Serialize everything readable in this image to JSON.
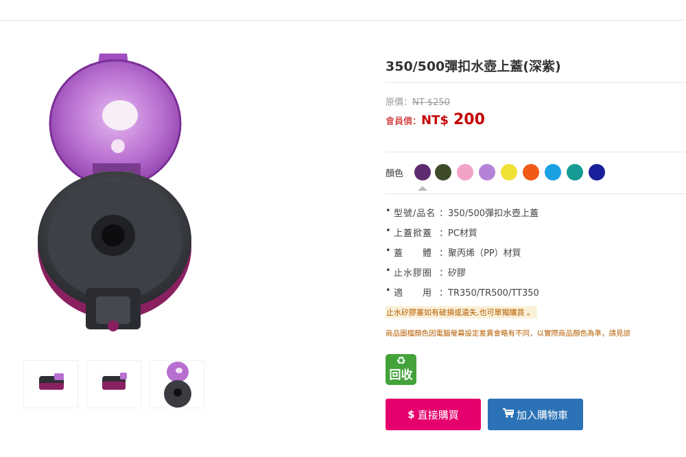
{
  "product": {
    "title": "350/500彈扣水壺上蓋(深紫)"
  },
  "pricing": {
    "original_label": "原價：",
    "original_price": "NT $250",
    "member_label": "會員價：",
    "member_currency": "NT$",
    "member_price": "200",
    "member_color": "#c40000"
  },
  "colors": {
    "label": "顏色",
    "options": [
      {
        "color": "#5e2b6e",
        "selected": true
      },
      {
        "color": "#3f4a2a",
        "selected": false
      },
      {
        "color": "#f4a3c8",
        "selected": false
      },
      {
        "color": "#b583d6",
        "selected": false
      },
      {
        "color": "#f2e135",
        "selected": false
      },
      {
        "color": "#f05a16",
        "selected": false
      },
      {
        "color": "#1ba0e2",
        "selected": false
      },
      {
        "color": "#159b94",
        "selected": false
      },
      {
        "color": "#1a1f9c",
        "selected": false
      }
    ]
  },
  "specs": [
    {
      "key": "型號/品名",
      "value": "：350/500彈扣水壺上蓋"
    },
    {
      "key": "上蓋掀蓋",
      "value": "：PC材質"
    },
    {
      "key": "蓋　　體",
      "value": "：聚丙烯（PP）材質"
    },
    {
      "key": "止水膠圈",
      "value": "：矽膠"
    },
    {
      "key": "適　　用",
      "value": "：TR350/TR500/TT350"
    }
  ],
  "bullet": "•",
  "notices": {
    "highlight": "止水矽膠塞如有破損或遺失,也可單獨購買 。",
    "disclaimer": "商品圖檔顏色因電腦螢幕設定差異會略有不同，以實際商品顏色為準，請見諒"
  },
  "recycle_badge": {
    "symbol": "♻",
    "text": "回收",
    "color": "#43a33a"
  },
  "buttons": {
    "buy_now_icon": "$",
    "buy_now": "直接購買",
    "add_to_cart": "加入購物車"
  },
  "accent_colors": {
    "buy_now": "#e5006d",
    "add_to_cart": "#2b73b6"
  }
}
